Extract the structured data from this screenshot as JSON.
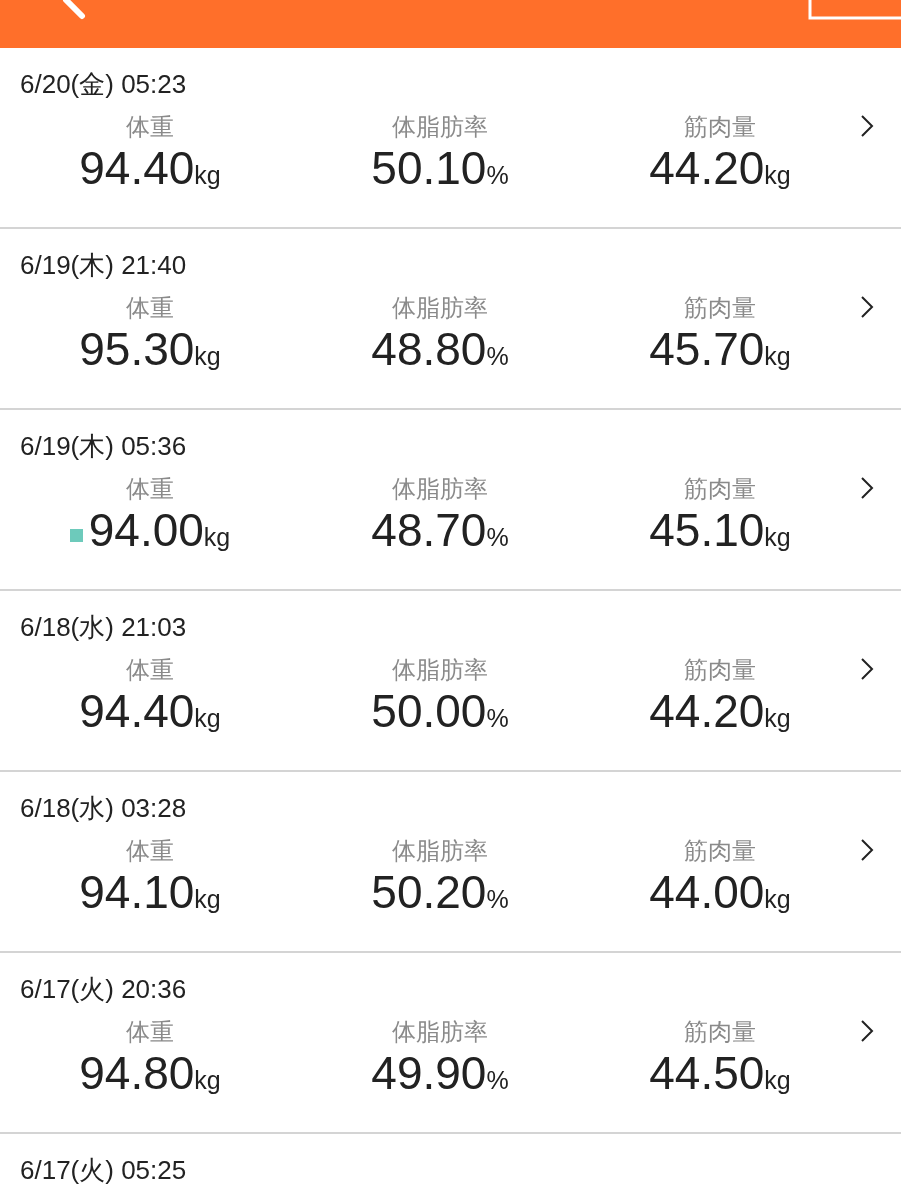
{
  "records": [
    {
      "datetime": "6/20(金) 05:23",
      "marked": false,
      "metrics": [
        {
          "label": "体重",
          "value": "94.40",
          "unit": "kg"
        },
        {
          "label": "体脂肪率",
          "value": "50.10",
          "unit": "%"
        },
        {
          "label": "筋肉量",
          "value": "44.20",
          "unit": "kg"
        }
      ]
    },
    {
      "datetime": "6/19(木) 21:40",
      "marked": false,
      "metrics": [
        {
          "label": "体重",
          "value": "95.30",
          "unit": "kg"
        },
        {
          "label": "体脂肪率",
          "value": "48.80",
          "unit": "%"
        },
        {
          "label": "筋肉量",
          "value": "45.70",
          "unit": "kg"
        }
      ]
    },
    {
      "datetime": "6/19(木) 05:36",
      "marked": true,
      "metrics": [
        {
          "label": "体重",
          "value": "94.00",
          "unit": "kg"
        },
        {
          "label": "体脂肪率",
          "value": "48.70",
          "unit": "%"
        },
        {
          "label": "筋肉量",
          "value": "45.10",
          "unit": "kg"
        }
      ]
    },
    {
      "datetime": "6/18(水) 21:03",
      "marked": false,
      "metrics": [
        {
          "label": "体重",
          "value": "94.40",
          "unit": "kg"
        },
        {
          "label": "体脂肪率",
          "value": "50.00",
          "unit": "%"
        },
        {
          "label": "筋肉量",
          "value": "44.20",
          "unit": "kg"
        }
      ]
    },
    {
      "datetime": "6/18(水) 03:28",
      "marked": false,
      "metrics": [
        {
          "label": "体重",
          "value": "94.10",
          "unit": "kg"
        },
        {
          "label": "体脂肪率",
          "value": "50.20",
          "unit": "%"
        },
        {
          "label": "筋肉量",
          "value": "44.00",
          "unit": "kg"
        }
      ]
    },
    {
      "datetime": "6/17(火) 20:36",
      "marked": false,
      "metrics": [
        {
          "label": "体重",
          "value": "94.80",
          "unit": "kg"
        },
        {
          "label": "体脂肪率",
          "value": "49.90",
          "unit": "%"
        },
        {
          "label": "筋肉量",
          "value": "44.50",
          "unit": "kg"
        }
      ]
    },
    {
      "datetime": "6/17(火) 05:25"
    }
  ]
}
